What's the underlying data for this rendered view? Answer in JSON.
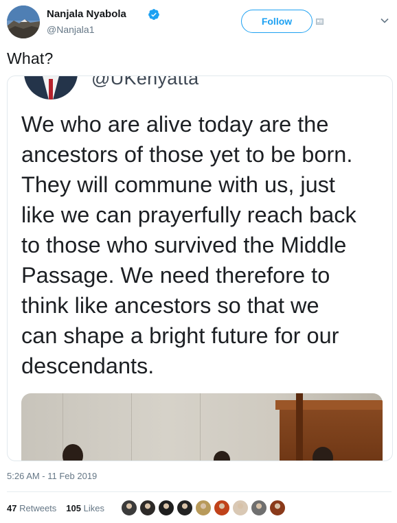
{
  "author": {
    "name": "Nanjala Nyabola",
    "handle": "@Nanjala1",
    "verified": true,
    "avatar_icon": "profile-photo-mountain"
  },
  "follow_label": "Follow",
  "tweet_text": "What?",
  "embedded_screenshot": {
    "handle": "@UKenyatta",
    "quote_lines": [
      "We who are alive today are the",
      "ancestors of those yet to be born.",
      "They will commune with us, just",
      "like we can prayerfully reach back",
      "to those who survived the Middle",
      "Passage. We need therefore to",
      "think like ancestors so that we",
      "can shape a bright future for our",
      "descendants."
    ]
  },
  "timestamp": "5:26 AM - 11 Feb 2019",
  "stats": {
    "retweets_count": "47",
    "retweets_label": "Retweets",
    "likes_count": "105",
    "likes_label": "Likes"
  },
  "likers": [
    {
      "color": "#3b3b3b"
    },
    {
      "color": "#2d2a28"
    },
    {
      "color": "#1e1e1e"
    },
    {
      "color": "#232323"
    },
    {
      "color": "#b89a5a"
    },
    {
      "color": "#c0421a"
    },
    {
      "color": "#d9c8b4"
    },
    {
      "color": "#6f6f6f"
    },
    {
      "color": "#8a3a1a"
    }
  ],
  "colors": {
    "accent": "#1da1f2",
    "secondary_text": "#657786"
  }
}
